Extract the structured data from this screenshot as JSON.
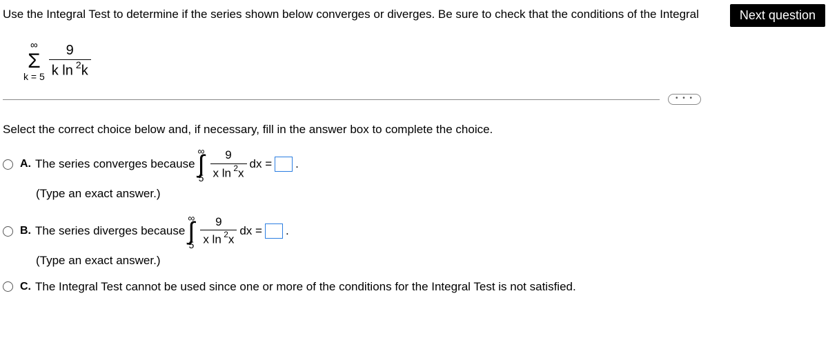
{
  "header": {
    "instruction": "Use the Integral Test to determine if the series shown below converges or diverges. Be sure to check that the conditions of the Integral",
    "next_button": "Next question"
  },
  "series": {
    "sigma_top": "∞",
    "sigma_symbol": "Σ",
    "sigma_bottom": "k = 5",
    "frac_num": "9",
    "frac_den_pre": "k ln",
    "frac_den_sup": "2",
    "frac_den_post": "k"
  },
  "more_label": "• • •",
  "select_prompt": "Select the correct choice below and, if necessary, fill in the answer box to complete the choice.",
  "choices": {
    "a": {
      "label": "A.",
      "text_before": "The series converges because",
      "int_top": "∞",
      "int_bot": "5",
      "frac_num": "9",
      "frac_den_pre": "x ln",
      "frac_den_sup": "2",
      "frac_den_post": "x",
      "dx_eq": "dx =",
      "period": ".",
      "hint": "(Type an exact answer.)"
    },
    "b": {
      "label": "B.",
      "text_before": "The series diverges because",
      "int_top": "∞",
      "int_bot": "5",
      "frac_num": "9",
      "frac_den_pre": "x ln",
      "frac_den_sup": "2",
      "frac_den_post": "x",
      "dx_eq": "dx =",
      "period": ".",
      "hint": "(Type an exact answer.)"
    },
    "c": {
      "label": "C.",
      "text": "The Integral Test cannot be used since one or more of the conditions for the Integral Test is not satisfied."
    }
  }
}
